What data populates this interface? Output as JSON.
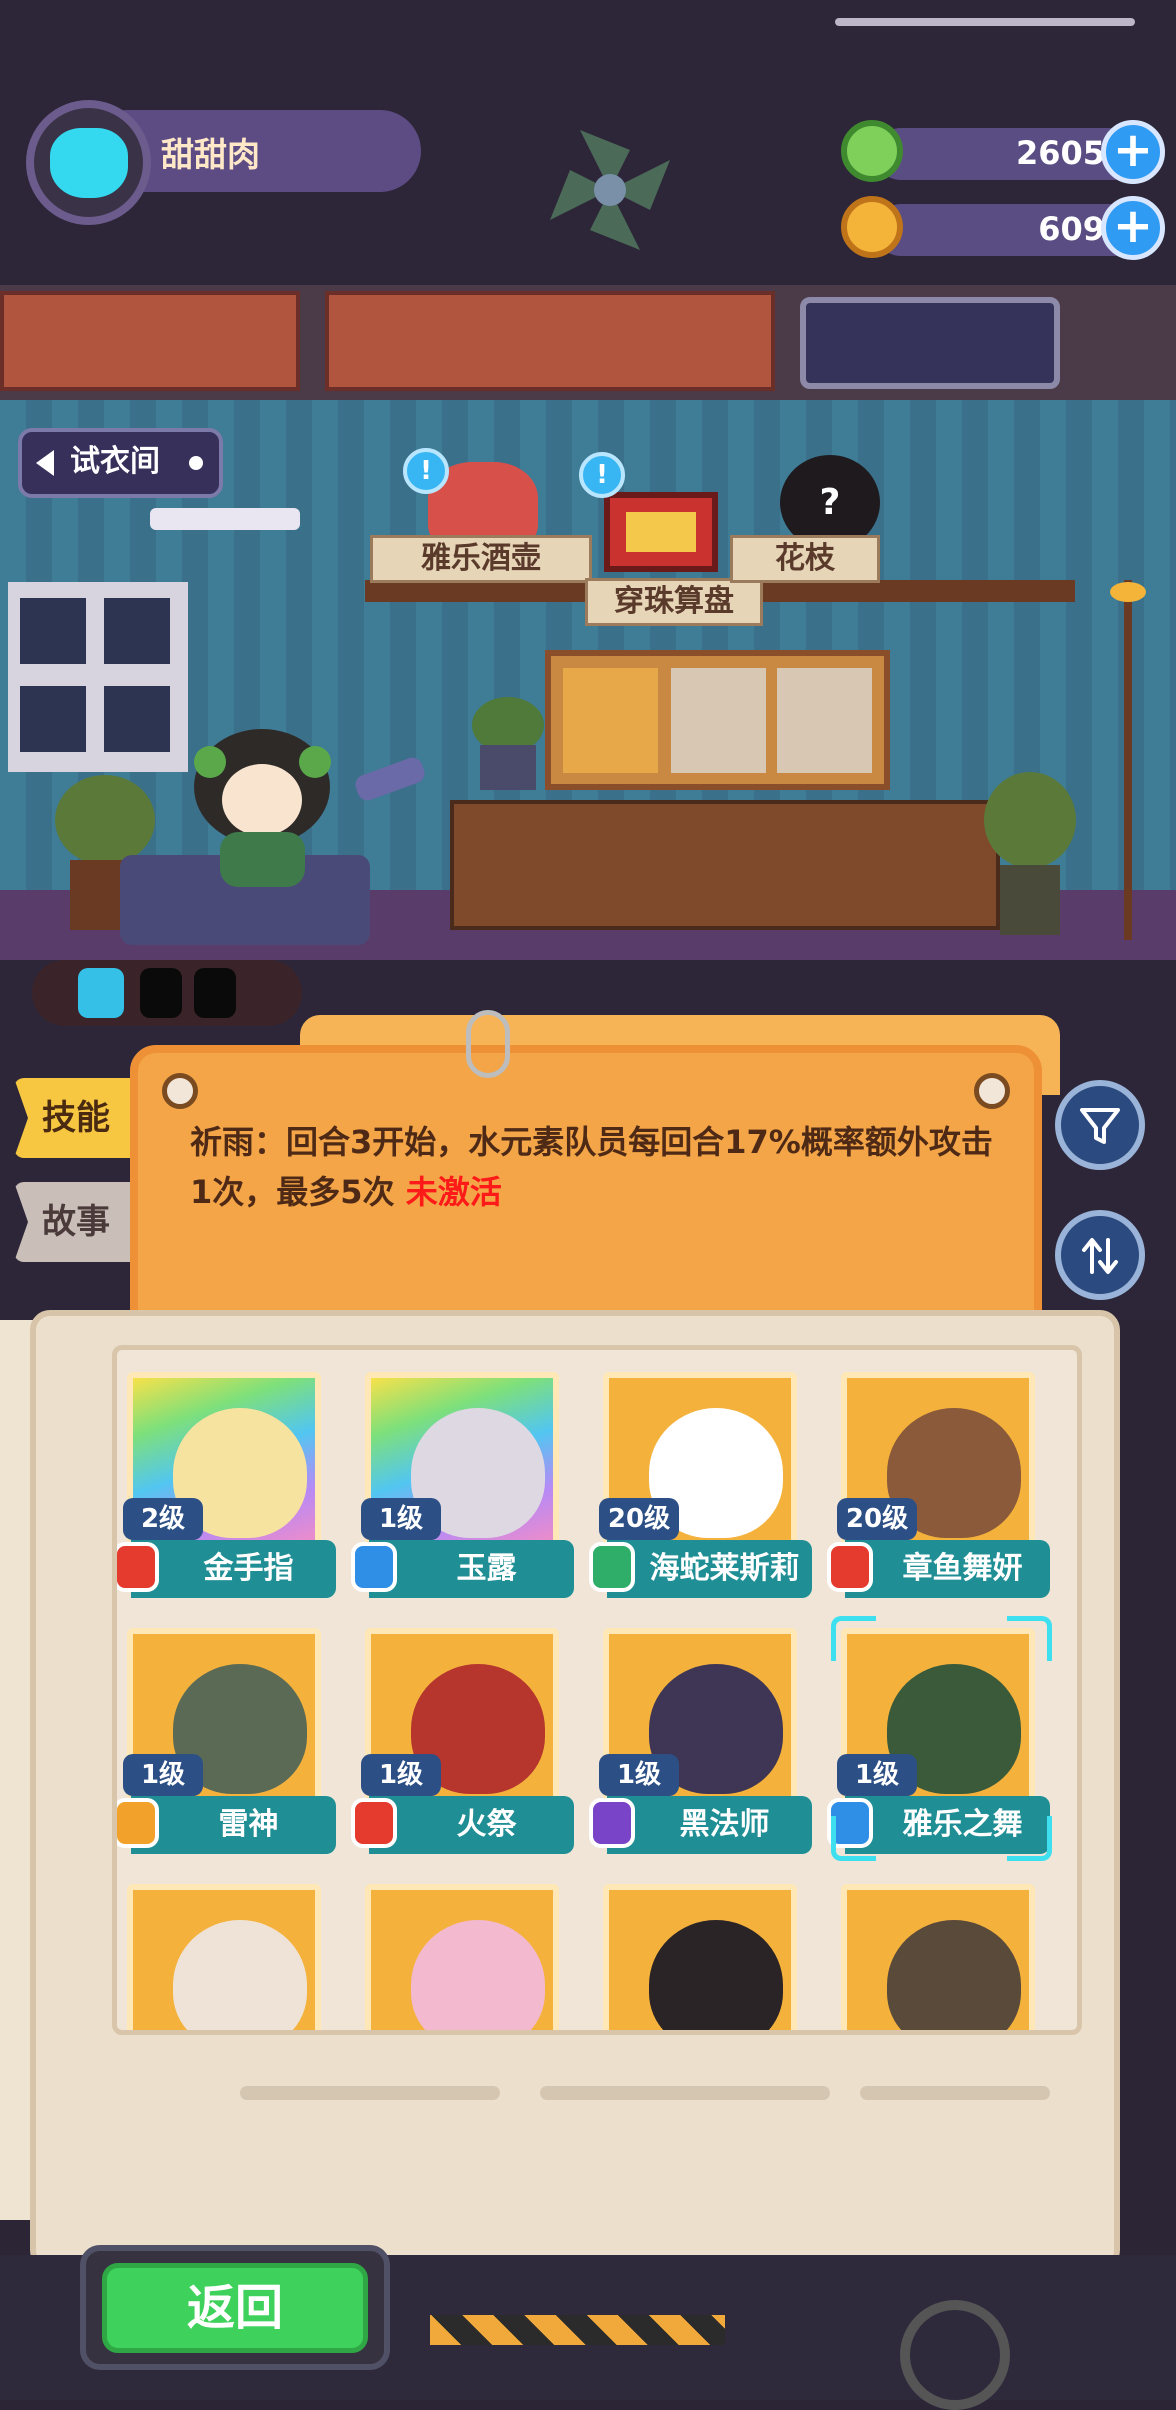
{
  "player": {
    "name": "甜甜肉"
  },
  "currencies": [
    {
      "name": "gem",
      "amount": "2605",
      "color": "#7ed05a"
    },
    {
      "name": "coin",
      "amount": "609",
      "color": "#f4b43a"
    }
  ],
  "room": {
    "try_on_label": "试衣间",
    "items": [
      {
        "label": "雅乐酒壶"
      },
      {
        "label": "穿珠算盘"
      },
      {
        "label": "花枝"
      }
    ],
    "unknown_item_mark": "?"
  },
  "tabs": [
    {
      "label": "技能"
    },
    {
      "label": "故事"
    }
  ],
  "skill": {
    "description": "祈雨：回合3开始，水元素队员每回合17%概率额外攻击1次，最多5次",
    "status": "未激活",
    "status_color": "#ff1a1a"
  },
  "characters": [
    {
      "level": "2级",
      "name": "金手指",
      "element_color": "#e53a2e",
      "frame": "rainbow",
      "face_color": "#f6e3a0"
    },
    {
      "level": "1级",
      "name": "玉露",
      "element_color": "#2f8fe6",
      "frame": "rainbow",
      "face_color": "#ddd8e2"
    },
    {
      "level": "20级",
      "name": "海蛇莱斯莉",
      "element_color": "#2fae6a",
      "frame": "gold",
      "face_color": "#ffffff"
    },
    {
      "level": "20级",
      "name": "章鱼舞妍",
      "element_color": "#e53a2e",
      "frame": "gold",
      "face_color": "#8a5a3a"
    },
    {
      "level": "1级",
      "name": "雷神",
      "element_color": "#f2a12a",
      "frame": "gold",
      "face_color": "#5a6a55"
    },
    {
      "level": "1级",
      "name": "火祭",
      "element_color": "#e53a2e",
      "frame": "gold",
      "face_color": "#b6362e"
    },
    {
      "level": "1级",
      "name": "黑法师",
      "element_color": "#7a44c8",
      "frame": "gold",
      "face_color": "#3e3654"
    },
    {
      "level": "1级",
      "name": "雅乐之舞",
      "element_color": "#2f8fe6",
      "frame": "gold",
      "face_color": "#3a5a3a",
      "selected": true
    },
    {
      "level": "",
      "name": "",
      "element_color": "#e53a2e",
      "frame": "gold",
      "face_color": "#efe3d8"
    },
    {
      "level": "",
      "name": "",
      "element_color": "#2f8fe6",
      "frame": "gold",
      "face_color": "#f2b9cf"
    },
    {
      "level": "",
      "name": "",
      "element_color": "#2f8fe6",
      "frame": "gold",
      "face_color": "#2a2426"
    },
    {
      "level": "",
      "name": "",
      "element_color": "#2f8fe6",
      "frame": "gold",
      "face_color": "#5a4a3a"
    }
  ],
  "back_button": {
    "label": "返回"
  },
  "icons": {
    "filter": "filter-icon",
    "sort": "sort-icon",
    "plus": "+"
  }
}
